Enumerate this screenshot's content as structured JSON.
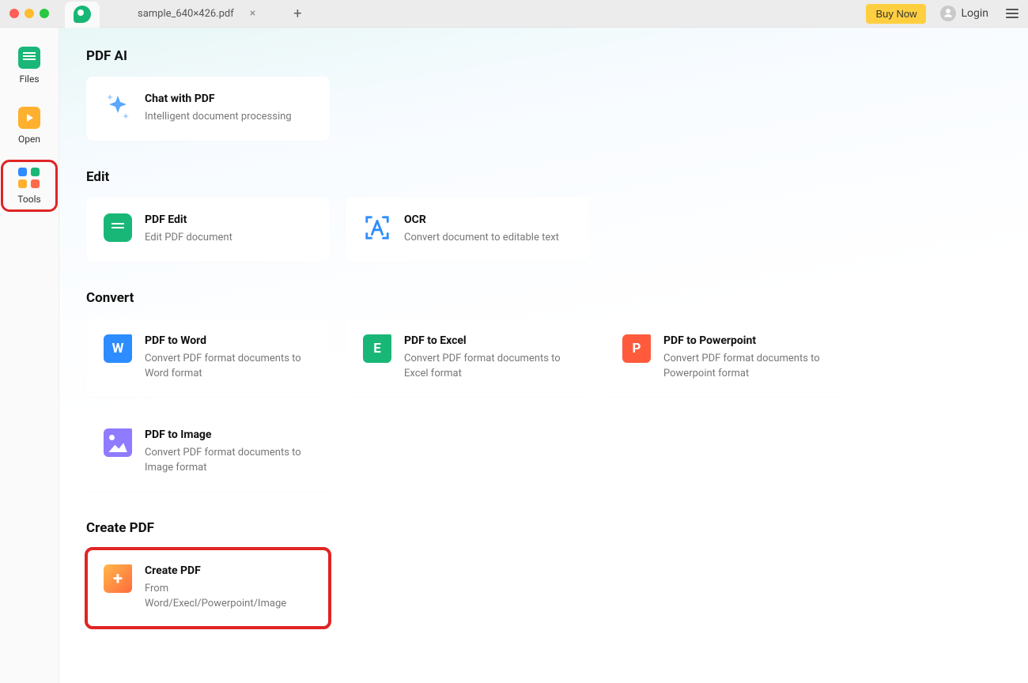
{
  "titlebar": {
    "doc_name": "sample_640×426.pdf",
    "buy_now": "Buy Now",
    "login": "Login"
  },
  "sidebar": {
    "items": [
      {
        "label": "Files"
      },
      {
        "label": "Open"
      },
      {
        "label": "Tools"
      }
    ]
  },
  "sections": {
    "pdf_ai": {
      "title": "PDF AI",
      "cards": [
        {
          "title": "Chat with PDF",
          "desc": "Intelligent document processing"
        }
      ]
    },
    "edit": {
      "title": "Edit",
      "cards": [
        {
          "title": "PDF Edit",
          "desc": "Edit PDF document"
        },
        {
          "title": "OCR",
          "desc": "Convert document to editable text"
        }
      ]
    },
    "convert": {
      "title": "Convert",
      "cards": [
        {
          "title": "PDF to Word",
          "desc": "Convert PDF format documents to Word format"
        },
        {
          "title": "PDF to Excel",
          "desc": "Convert PDF format documents to Excel format"
        },
        {
          "title": "PDF to Powerpoint",
          "desc": "Convert PDF format documents to Powerpoint format"
        },
        {
          "title": "PDF to Image",
          "desc": "Convert PDF format documents to Image format"
        }
      ]
    },
    "create": {
      "title": "Create PDF",
      "cards": [
        {
          "title": "Create PDF",
          "desc": "From Word/Execl/Powerpoint/Image"
        }
      ]
    }
  }
}
